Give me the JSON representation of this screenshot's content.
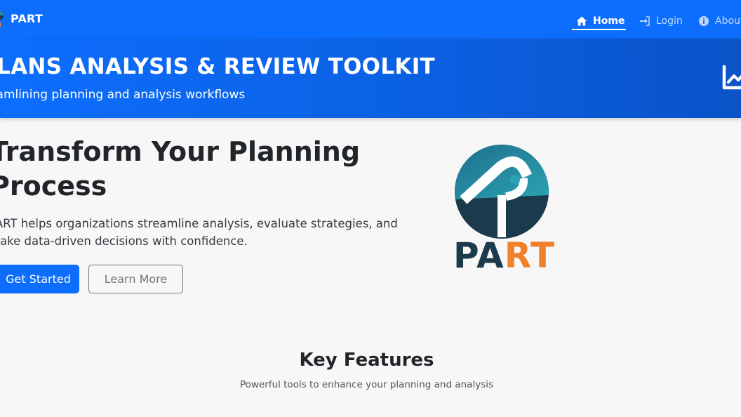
{
  "navbar": {
    "brand": "PART",
    "items": [
      {
        "label": "Home",
        "icon": "home-icon",
        "active": true
      },
      {
        "label": "Login",
        "icon": "login-icon",
        "active": false
      },
      {
        "label": "About",
        "icon": "info-icon",
        "active": false
      }
    ]
  },
  "banner": {
    "title": "PLANS ANALYSIS & REVIEW TOOLKIT",
    "subtitle": "Streamlining planning and analysis workflows",
    "icon": "chart-line-icon"
  },
  "hero": {
    "title": "Transform Your Planning Process",
    "description": "PART helps organizations streamline analysis, evaluate strategies, and make data-driven decisions with confidence.",
    "primary_button": "Get Started",
    "secondary_button": "Learn More"
  },
  "logo": {
    "word_part1": "PA",
    "word_part2": "RT"
  },
  "features": {
    "title": "Key Features",
    "subtitle": "Powerful tools to enhance your planning and analysis"
  },
  "colors": {
    "primary": "#0d6efd",
    "logo_dark": "#1b3a4b",
    "logo_teal": "#2a8a9e",
    "logo_orange": "#f0802a"
  }
}
